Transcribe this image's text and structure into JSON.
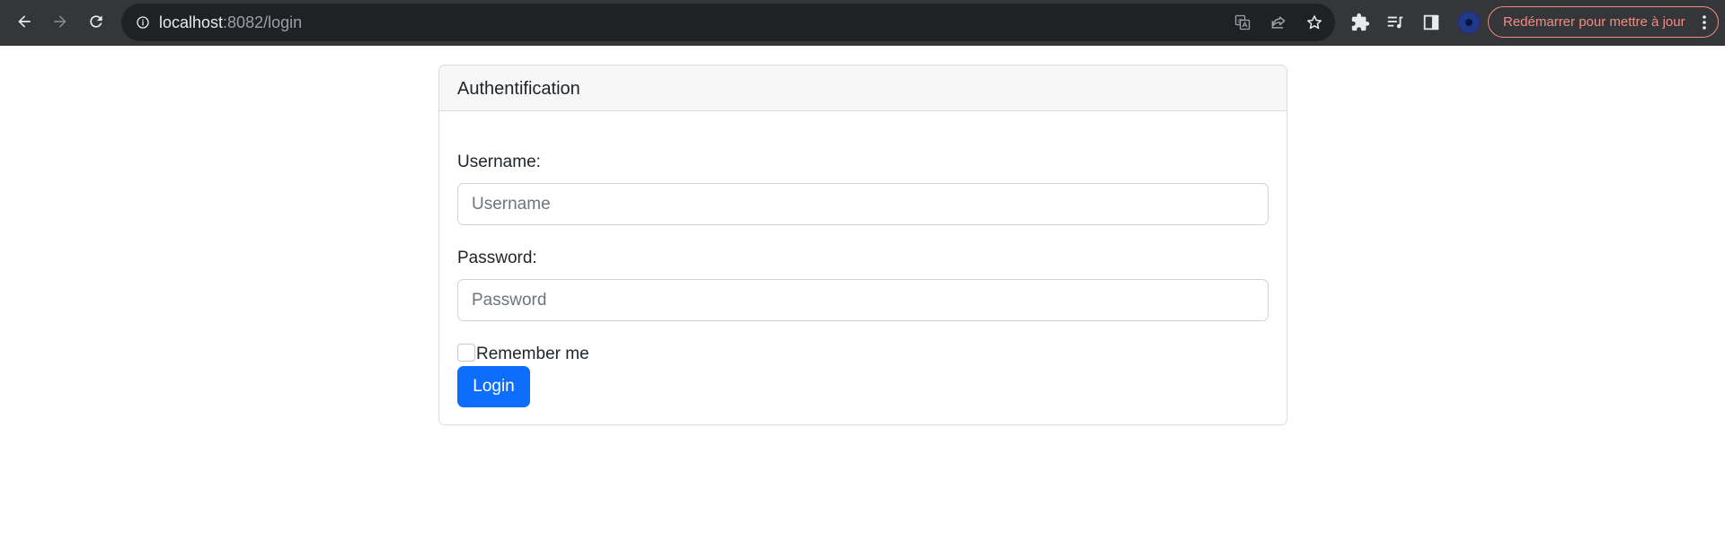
{
  "browser": {
    "url_host": "localhost",
    "url_path": ":8082/login",
    "update_button_label": "Redémarrer pour mettre à jour",
    "icons": {
      "back": "arrow-left-icon",
      "forward": "arrow-right-icon",
      "reload": "reload-icon",
      "site_info": "info-icon",
      "translate": "translate-icon",
      "share": "share-icon",
      "bookmark": "star-icon",
      "extensions": "puzzle-icon",
      "reading_list": "reading-list-icon",
      "side_panel": "side-panel-icon",
      "menu": "kebab-menu-icon"
    },
    "colors": {
      "toolbar": "#35363a",
      "omnibox": "#202124",
      "update_accent": "#f28b82"
    }
  },
  "login_card": {
    "title": "Authentification",
    "username": {
      "label": "Username:",
      "placeholder": "Username",
      "value": ""
    },
    "password": {
      "label": "Password:",
      "placeholder": "Password",
      "value": ""
    },
    "remember_me": {
      "label": "Remember me",
      "checked": false
    },
    "submit_label": "Login"
  },
  "colors": {
    "primary": "#0d6efd",
    "card_header_bg": "#f7f7f7",
    "border": "#dcdcdc"
  }
}
